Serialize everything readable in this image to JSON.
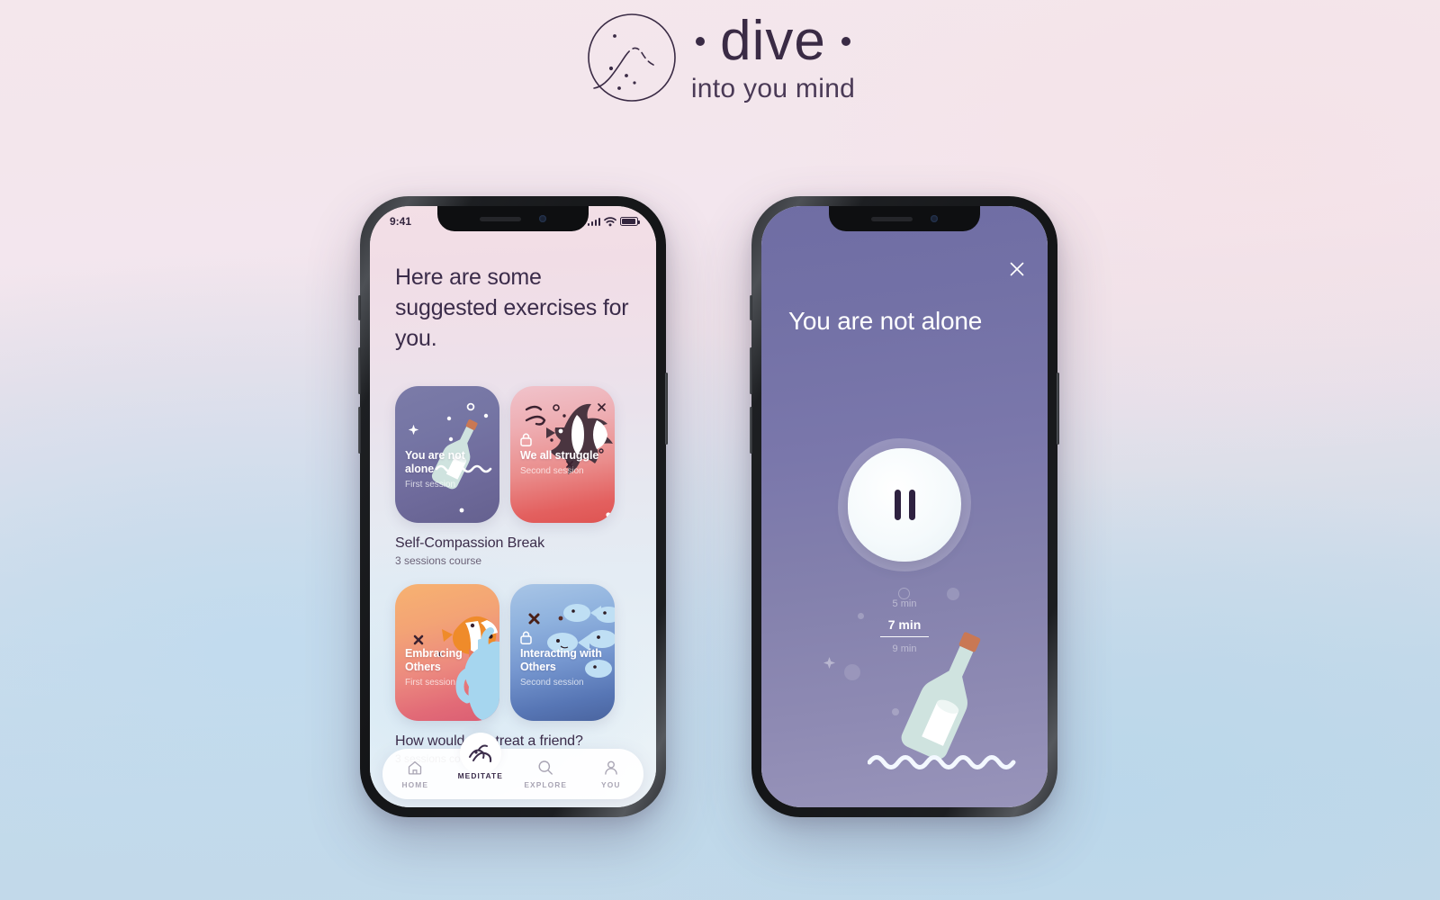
{
  "brand": {
    "name": "dive",
    "tagline": "into you mind",
    "logo_icon": "circle-wave-dots-icon",
    "bullet_left": "•",
    "bullet_right": "•",
    "ink_color": "#3a2b45"
  },
  "background": {
    "top_color": "#f4e7ec",
    "bottom_color": "#c4d9e8"
  },
  "phone_left": {
    "status_bar": {
      "time": "9:41",
      "signal_icon": "signal-bars-icon",
      "wifi_icon": "wifi-icon",
      "battery_icon": "battery-icon"
    },
    "heading": "Here are some suggested exercises for you.",
    "courses": [
      {
        "title": "Self-Compassion Break",
        "subtitle": "3 sessions course",
        "cards": [
          {
            "title": "You are not alone",
            "session": "First session",
            "locked": false,
            "art": "message-bottle-icon",
            "accent": "#6f6b9c"
          },
          {
            "title": "We all struggle",
            "session": "Second session",
            "locked": true,
            "lock_icon": "lock-icon",
            "art": "angelfish-icon",
            "accent": "#e3605f"
          }
        ]
      },
      {
        "title": "How would you treat a friend?",
        "subtitle": "3 sessions course",
        "cards": [
          {
            "title": "Embracing Others",
            "session": "First session",
            "locked": false,
            "art": "clownfish-coral-icon",
            "accent": "#ec8a7f"
          },
          {
            "title": "Interacting with Others",
            "session": "Second session",
            "locked": true,
            "lock_icon": "lock-icon",
            "art": "fish-school-icon",
            "accent": "#5776b5"
          }
        ]
      }
    ],
    "tabs": [
      {
        "label": "HOME",
        "icon": "home-icon",
        "active": false
      },
      {
        "label": "MEDITATE",
        "icon": "wave-icon",
        "active": true
      },
      {
        "label": "EXPLORE",
        "icon": "search-icon",
        "active": false
      },
      {
        "label": "YOU",
        "icon": "person-icon",
        "active": false
      }
    ]
  },
  "phone_right": {
    "close_icon": "close-icon",
    "title": "You are not alone",
    "player": {
      "state": "playing",
      "button_icon": "pause-icon"
    },
    "durations": [
      {
        "label": "5 min",
        "selected": false
      },
      {
        "label": "7 min",
        "selected": true
      },
      {
        "label": "9 min",
        "selected": false
      }
    ],
    "art": "message-bottle-waves-icon",
    "background_color": "#7a77ab"
  }
}
